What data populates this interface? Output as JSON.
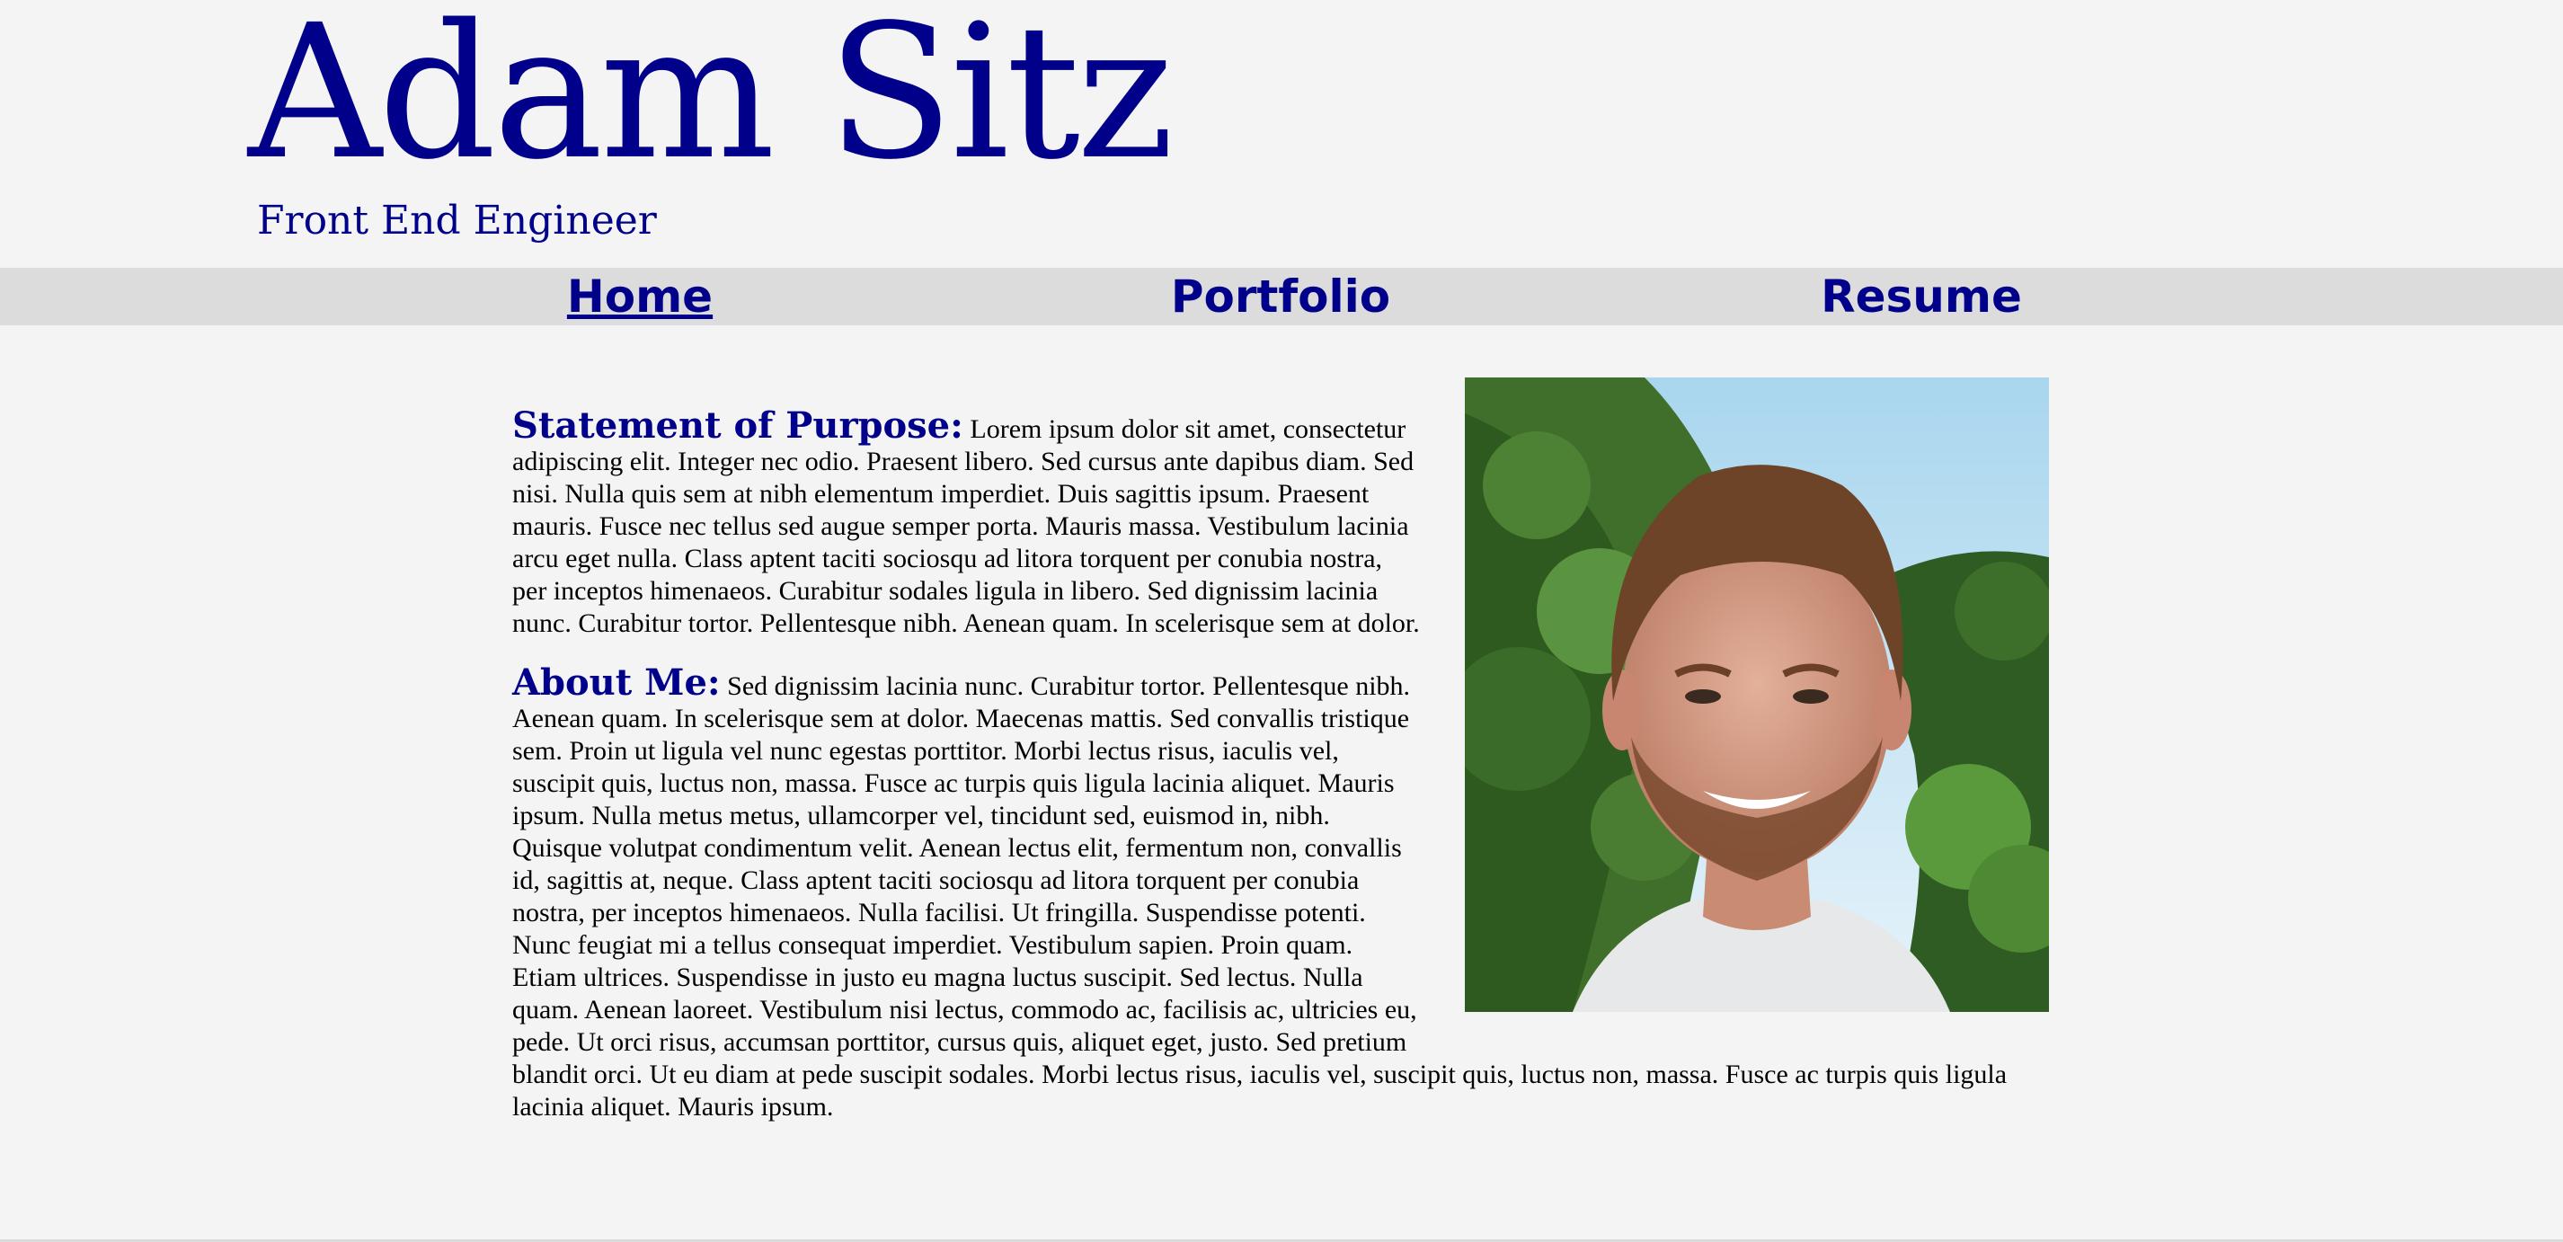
{
  "header": {
    "title": "Adam Sitz",
    "subtitle": "Front End Engineer"
  },
  "nav": {
    "items": [
      {
        "label": "Home",
        "active": true
      },
      {
        "label": "Portfolio",
        "active": false
      },
      {
        "label": "Resume",
        "active": false
      }
    ]
  },
  "content": {
    "purpose": {
      "heading": "Statement of Purpose:",
      "text": " Lorem ipsum dolor sit amet, consectetur adipiscing elit. Integer nec odio. Praesent libero. Sed cursus ante dapibus diam. Sed nisi. Nulla quis sem at nibh elementum imperdiet. Duis sagittis ipsum. Praesent mauris. Fusce nec tellus sed augue semper porta. Mauris massa. Vestibulum lacinia arcu eget nulla. Class aptent taciti sociosqu ad litora torquent per conubia nostra, per inceptos himenaeos. Curabitur sodales ligula in libero. Sed dignissim lacinia nunc. Curabitur tortor. Pellentesque nibh. Aenean quam. In scelerisque sem at dolor."
    },
    "about": {
      "heading": "About Me:",
      "text": " Sed dignissim lacinia nunc. Curabitur tortor. Pellentesque nibh. Aenean quam. In scelerisque sem at dolor. Maecenas mattis. Sed convallis tristique sem. Proin ut ligula vel nunc egestas porttitor. Morbi lectus risus, iaculis vel, suscipit quis, luctus non, massa. Fusce ac turpis quis ligula lacinia aliquet. Mauris ipsum. Nulla metus metus, ullamcorper vel, tincidunt sed, euismod in, nibh. Quisque volutpat condimentum velit. Aenean lectus elit, fermentum non, convallis id, sagittis at, neque. Class aptent taciti sociosqu ad litora torquent per conubia nostra, per inceptos himenaeos. Nulla facilisi. Ut fringilla. Suspendisse potenti. Nunc feugiat mi a tellus consequat imperdiet. Vestibulum sapien. Proin quam. Etiam ultrices. Suspendisse in justo eu magna luctus suscipit. Sed lectus. Nulla quam. Aenean laoreet. Vestibulum nisi lectus, commodo ac, facilisis ac, ultricies eu, pede. Ut orci risus, accumsan porttitor, cursus quis, aliquet eget, justo. Sed pretium blandit orci. Ut eu diam at pede suscipit sodales. Morbi lectus risus, iaculis vel, suscipit quis, luctus non, massa. Fusce ac turpis quis ligula lacinia aliquet. Mauris ipsum."
    }
  },
  "colors": {
    "accent": "#00008b",
    "background": "#f4f4f4",
    "nav_background": "#dcdcdc"
  }
}
